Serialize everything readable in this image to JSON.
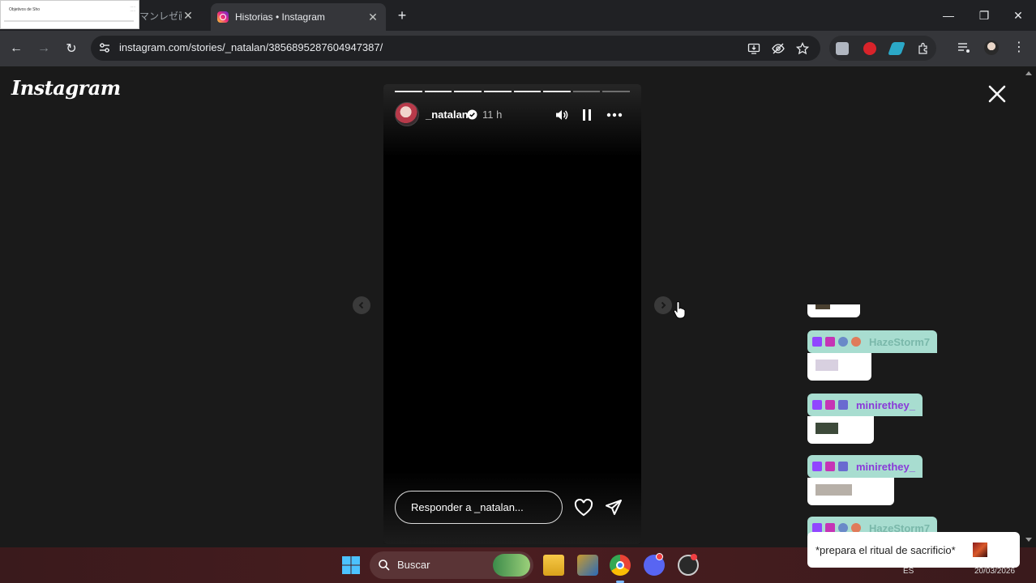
{
  "browser": {
    "tabs": [
      {
        "label": "マンレゼ画",
        "active": false
      },
      {
        "label": "Historias • Instagram",
        "active": true
      }
    ],
    "thumbnail": {
      "title": "Objetivos de Sho"
    },
    "url": "instagram.com/stories/_natalan/3856895287604947387/"
  },
  "page": {
    "logo": "Instagram",
    "story": {
      "username": "_natalan",
      "time": "11 h",
      "segments": 8,
      "current_segment": 6,
      "reply_placeholder": "Responder a _natalan..."
    }
  },
  "chat": {
    "messages": [
      {
        "name": "HazeStorm7",
        "color": "#7ab8aa"
      },
      {
        "name": "minirethey_",
        "color": "#8a3ad8"
      },
      {
        "name": "minirethey_",
        "color": "#8a3ad8"
      },
      {
        "name": "HazeStorm7",
        "color": "#7ab8aa"
      }
    ],
    "last_text": "*prepara el ritual de sacrificio*"
  },
  "taskbar": {
    "search_label": "Buscar",
    "lang": "ES",
    "date": "20/03/2026"
  },
  "colors": {
    "accent_chat": "#a8ddd0",
    "taskbar": "#4a1d20"
  }
}
